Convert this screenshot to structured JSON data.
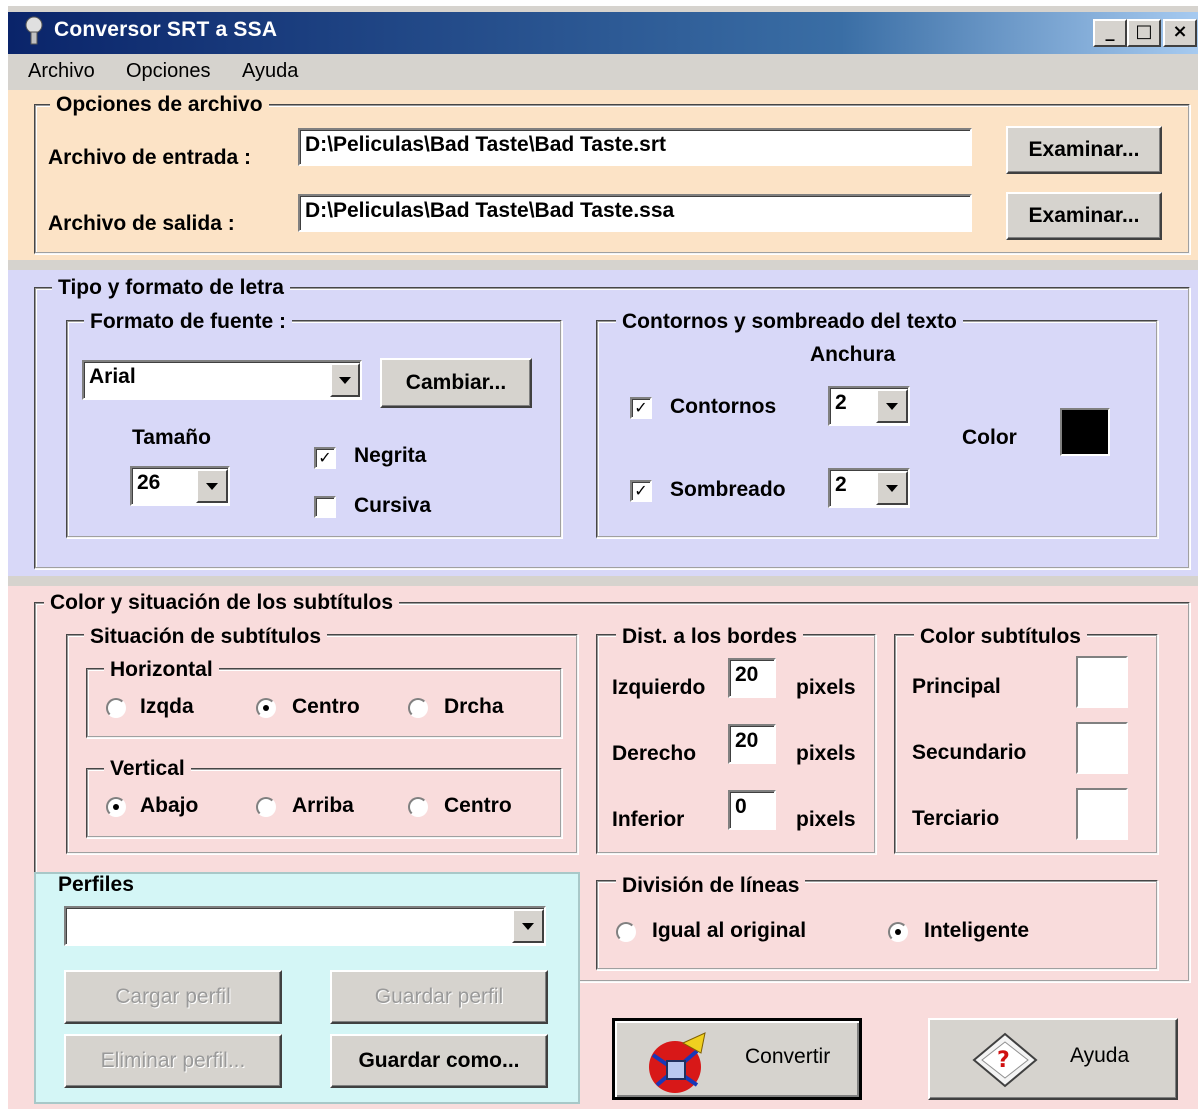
{
  "window": {
    "title": "Conversor SRT a SSA",
    "controls": {
      "minimize": "_",
      "maximize": "□",
      "close": "×"
    }
  },
  "menu": {
    "items": [
      "Archivo",
      "Opciones",
      "Ayuda"
    ]
  },
  "file_options": {
    "legend": "Opciones de archivo",
    "input_label": "Archivo de entrada :",
    "input_value": "D:\\Peliculas\\Bad Taste\\Bad Taste.srt",
    "output_label": "Archivo de salida :",
    "output_value": "D:\\Peliculas\\Bad Taste\\Bad Taste.ssa",
    "browse_label": "Examinar..."
  },
  "font_section": {
    "legend": "Tipo y formato de letra",
    "font_format": {
      "legend": "Formato de fuente  :",
      "font_value": "Arial",
      "change_label": "Cambiar...",
      "size_label": "Tamaño",
      "size_value": "26",
      "bold_label": "Negrita",
      "bold_checked": true,
      "italic_label": "Cursiva",
      "italic_checked": false
    },
    "outline": {
      "legend": "Contornos y sombreado del texto",
      "width_label": "Anchura",
      "outline_label": "Contornos",
      "outline_checked": true,
      "outline_width": "2",
      "shadow_label": "Sombreado",
      "shadow_checked": true,
      "shadow_width": "2",
      "color_label": "Color",
      "color_value": "#000000"
    }
  },
  "subtitle_section": {
    "legend": "Color y situación de los subtítulos",
    "position": {
      "legend": "Situación de subtítulos",
      "horizontal_legend": "Horizontal",
      "horizontal_options": [
        "Izqda",
        "Centro",
        "Drcha"
      ],
      "horizontal_selected": "Centro",
      "vertical_legend": "Vertical",
      "vertical_options": [
        "Abajo",
        "Arriba",
        "Centro"
      ],
      "vertical_selected": "Abajo"
    },
    "borders": {
      "legend": "Dist. a los bordes",
      "left_label": "Izquierdo",
      "left_value": "20",
      "right_label": "Derecho",
      "right_value": "20",
      "bottom_label": "Inferior",
      "bottom_value": "0",
      "unit": "pixels"
    },
    "colors": {
      "legend": "Color subtítulos",
      "primary_label": "Principal",
      "secondary_label": "Secundario",
      "tertiary_label": "Terciario",
      "swatch_color": "#ffffff"
    },
    "line_split": {
      "legend": "División de líneas",
      "options": [
        "Igual al original",
        "Inteligente"
      ],
      "selected": "Inteligente"
    }
  },
  "profiles": {
    "legend": "Perfiles",
    "selected_value": "",
    "load_label": "Cargar perfil",
    "save_label": "Guardar perfil",
    "delete_label": "Eliminar perfil...",
    "save_as_label": "Guardar como..."
  },
  "actions": {
    "convert_label": "Convertir",
    "help_label": "Ayuda"
  },
  "colors": {
    "file_panel": "#fce3c6",
    "font_panel": "#d8d8f8",
    "subtitle_panel": "#f9dcdc",
    "profile_panel": "#d4f6f6",
    "title_gradient_start": "#0a246a"
  }
}
